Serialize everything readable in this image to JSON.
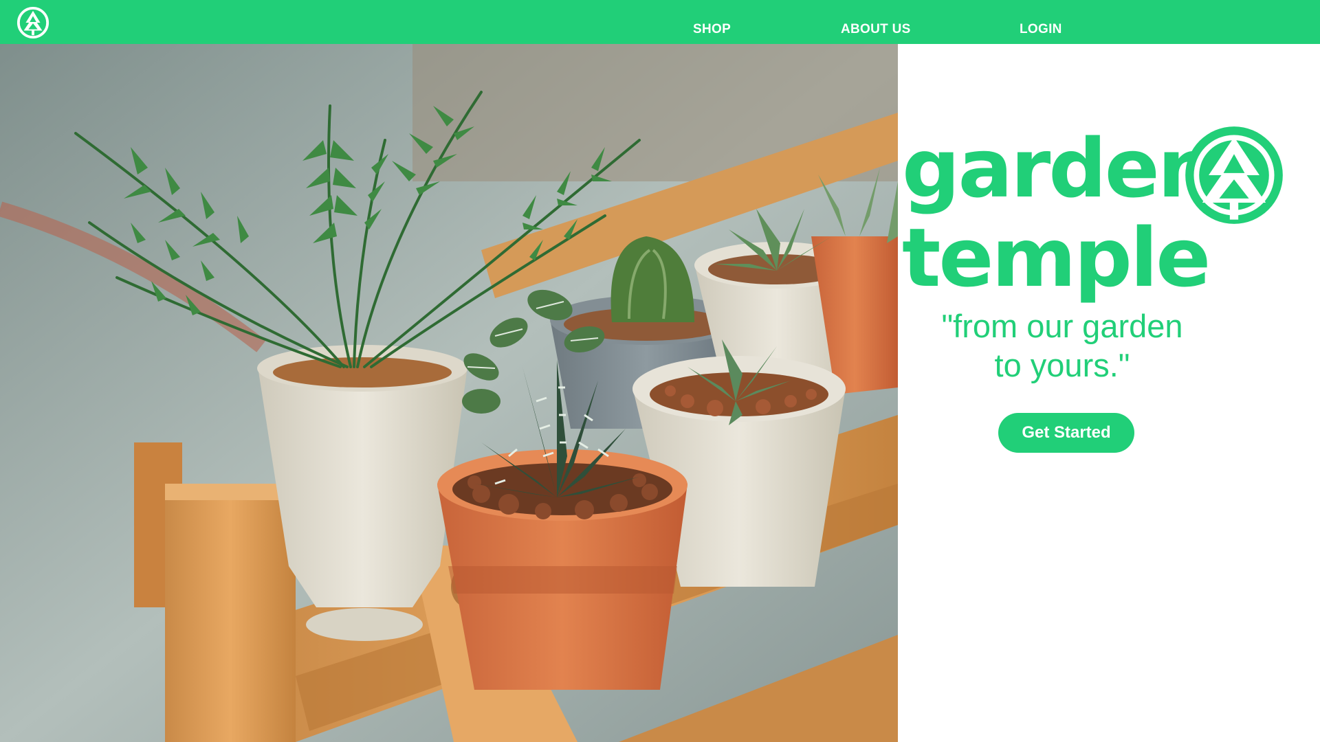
{
  "nav": {
    "logo_icon": "pine-tree-circle-icon",
    "links": [
      {
        "label": "SHOP"
      },
      {
        "label": "ABOUT US"
      },
      {
        "label": "LOGIN"
      }
    ]
  },
  "hero": {
    "image_icon": "potted-plants-photo",
    "brand_line_1": "garden",
    "brand_line_2": "temple",
    "brand_icon": "pine-tree-circle-icon",
    "tagline_line_1": "\"from our garden",
    "tagline_line_2": "to yours.\"",
    "cta_label": "Get Started"
  },
  "colors": {
    "brand_green": "#21cf78",
    "background": "#ffffff",
    "nav_text": "#ffffff"
  }
}
